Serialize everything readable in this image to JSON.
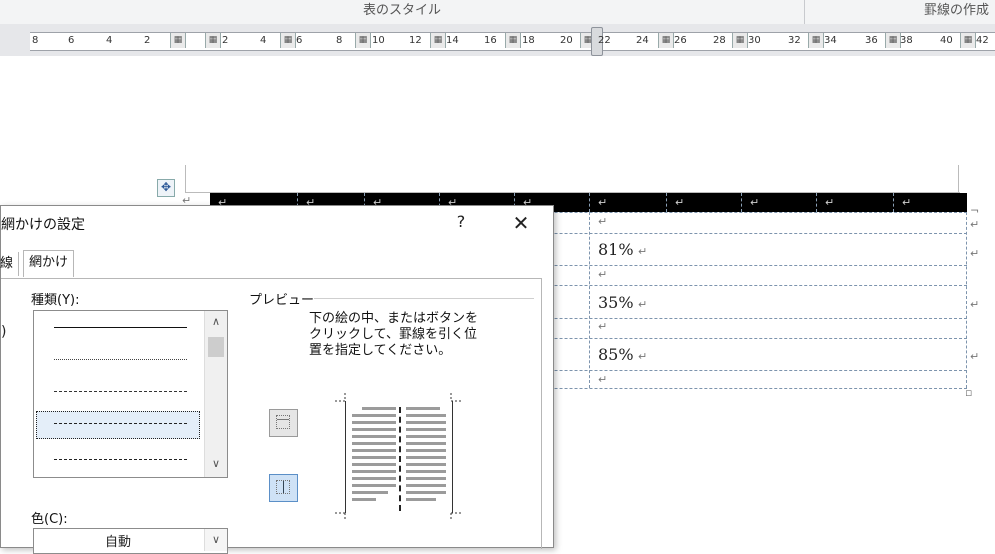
{
  "ribbon": {
    "group_table_style": "表のスタイル",
    "group_draw_borders": "罫線の作成"
  },
  "ruler": {
    "ticks": [
      "8",
      "6",
      "4",
      "2",
      "2",
      "4",
      "6",
      "8",
      "10",
      "12",
      "14",
      "16",
      "18",
      "20",
      "22",
      "24",
      "26",
      "28",
      "30",
      "32",
      "34",
      "36",
      "38",
      "40",
      "42"
    ],
    "column_marker_glyph": "ﾛｰﾙ"
  },
  "document": {
    "move_handle_glyph": "✥",
    "paragraph_mark": "↵",
    "cell_end_mark": "¬",
    "header_cells": [
      "↵",
      "↵",
      "↵",
      "↵",
      "↵",
      "↵",
      "↵",
      "↵",
      "↵",
      "↵"
    ],
    "values": [
      "81%",
      "35%",
      "85%"
    ]
  },
  "dialog": {
    "title": "網かけの設定",
    "help_button": "?",
    "close_button": "✕",
    "tabs": [
      "線",
      "網かけ"
    ],
    "style_label": "種類(Y):",
    "color_label": "色(C):",
    "color_value": "自動",
    "preview_label": "プレビュー",
    "preview_hint": "下の絵の中、またはボタンを\nクリックして、罫線を引く位\n置を指定してください。",
    "scroll_up": "∧",
    "scroll_down": "∨",
    "dropdown_arrow": "∨"
  },
  "colors": {
    "header_fill": "#000000",
    "dashed_border": "#7d94ad",
    "selected_button": "#cfe2f6"
  }
}
